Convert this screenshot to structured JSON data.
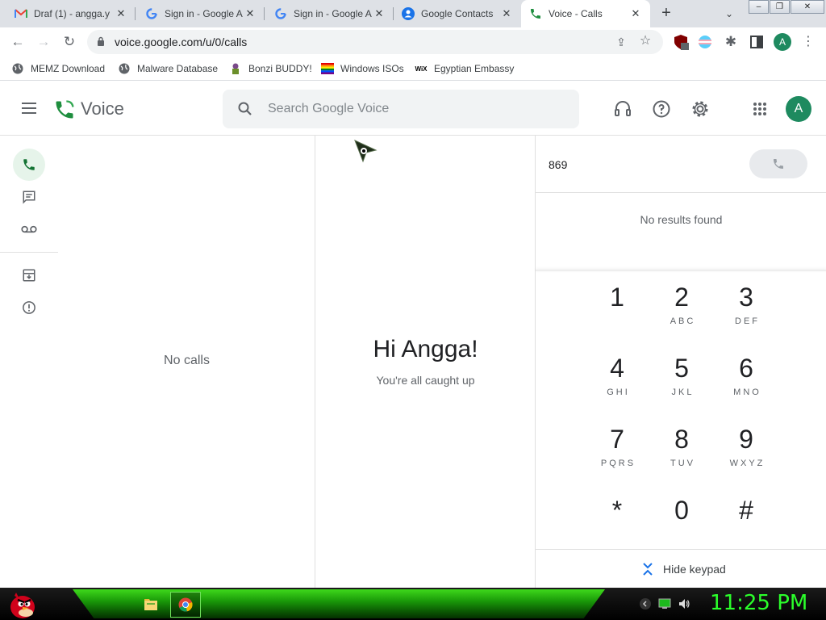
{
  "browser": {
    "tabs": [
      {
        "title": "Draf (1) - angga.y",
        "favicon": "gmail-icon"
      },
      {
        "title": "Sign in - Google A",
        "favicon": "google-g-icon"
      },
      {
        "title": "Sign in - Google A",
        "favicon": "google-g-icon"
      },
      {
        "title": "Google Contacts",
        "favicon": "contacts-icon"
      },
      {
        "title": "Voice - Calls",
        "favicon": "voice-icon",
        "active": true
      }
    ],
    "url": "voice.google.com/u/0/calls",
    "profile_initial": "A",
    "extension_badge": "6",
    "bookmarks": [
      {
        "label": "MEMZ Download",
        "icon": "globe-icon"
      },
      {
        "label": "Malware Database",
        "icon": "globe-icon"
      },
      {
        "label": "Bonzi BUDDY!",
        "icon": "bonzi-icon"
      },
      {
        "label": "Windows ISOs",
        "icon": "windows-icon"
      },
      {
        "label": "Egyptian Embassy",
        "icon": "wix-icon"
      }
    ]
  },
  "voice": {
    "app_title": "Voice",
    "search_placeholder": "Search Google Voice",
    "avatar_initial": "A",
    "calls_empty": "No calls",
    "greeting": "Hi Angga!",
    "subgreeting": "You're all caught up",
    "dialer": {
      "number": "869",
      "no_results": "No results found",
      "keys": [
        {
          "digit": "1",
          "letters": ""
        },
        {
          "digit": "2",
          "letters": "ABC"
        },
        {
          "digit": "3",
          "letters": "DEF"
        },
        {
          "digit": "4",
          "letters": "GHI"
        },
        {
          "digit": "5",
          "letters": "JKL"
        },
        {
          "digit": "6",
          "letters": "MNO"
        },
        {
          "digit": "7",
          "letters": "PQRS"
        },
        {
          "digit": "8",
          "letters": "TUV"
        },
        {
          "digit": "9",
          "letters": "WXYZ"
        },
        {
          "digit": "*",
          "letters": ""
        },
        {
          "digit": "0",
          "letters": ""
        },
        {
          "digit": "#",
          "letters": ""
        }
      ],
      "hide_keypad": "Hide keypad"
    }
  },
  "taskbar": {
    "clock": "11:25 PM"
  },
  "colors": {
    "voice_green": "#1e8e3e",
    "avatar": "#1e8a5f",
    "taskbar_glow": "#3ed91b",
    "clock": "#2bff2b"
  }
}
